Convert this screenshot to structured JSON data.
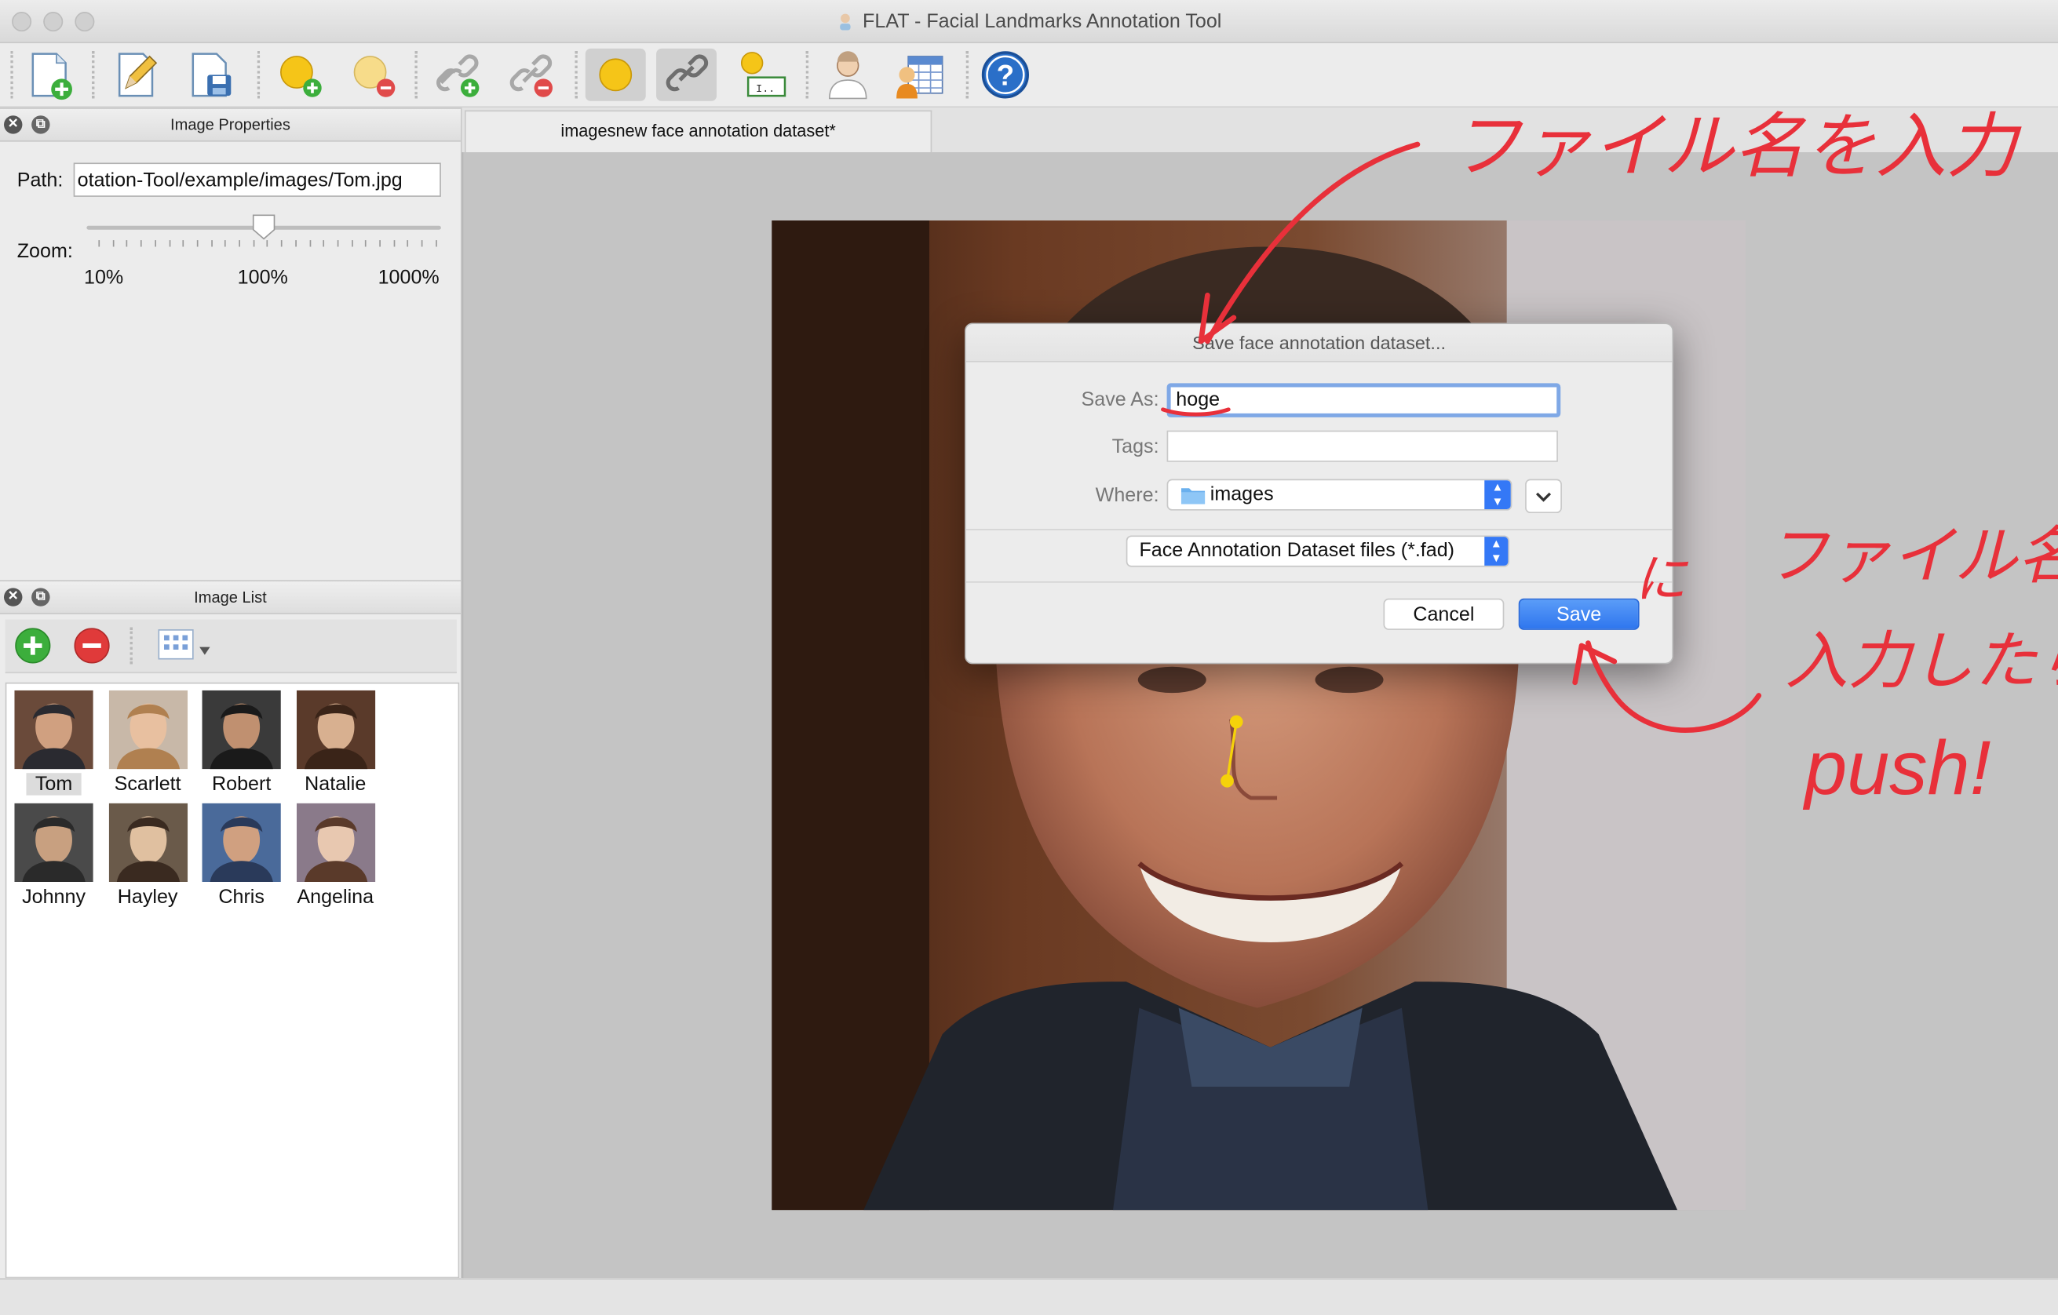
{
  "window": {
    "title": "FLAT - Facial Landmarks Annotation Tool"
  },
  "toolbar": {
    "buttons": [
      "new-dataset-icon",
      "edit-dataset-icon",
      "save-dataset-icon",
      "add-landmark-icon",
      "remove-landmark-icon",
      "add-link-icon",
      "remove-link-icon",
      "show-landmarks-icon",
      "show-links-icon",
      "landmark-id-icon",
      "face-fit-icon",
      "properties-grid-icon",
      "help-icon"
    ]
  },
  "properties_panel": {
    "title": "Image Properties",
    "path_label": "Path:",
    "path_value": "otation-Tool/example/images/Tom.jpg",
    "zoom_label": "Zoom:",
    "zoom_min": "10%",
    "zoom_mid": "100%",
    "zoom_max": "1000%",
    "zoom_value": 100
  },
  "image_list_panel": {
    "title": "Image List",
    "images": [
      {
        "name": "Tom",
        "selected": true
      },
      {
        "name": "Scarlett"
      },
      {
        "name": "Robert"
      },
      {
        "name": "Natalie"
      },
      {
        "name": "Johnny"
      },
      {
        "name": "Hayley"
      },
      {
        "name": "Chris"
      },
      {
        "name": "Angelina"
      }
    ]
  },
  "document_tab": {
    "label": "imagesnew face annotation dataset*"
  },
  "dialog": {
    "title": "Save face annotation dataset...",
    "save_as_label": "Save As:",
    "save_as_value": "hoge",
    "tags_label": "Tags:",
    "tags_value": "",
    "where_label": "Where:",
    "where_value": "images",
    "file_type": "Face Annotation Dataset files (*.fad)",
    "cancel_label": "Cancel",
    "save_label": "Save"
  },
  "annotations": {
    "top_note": "ファイル名を入力",
    "side_note_1": "ファイル名を",
    "side_note_2": "入力したら",
    "side_note_3": "push!",
    "side_note_prefix": "に",
    "color": "#e8303a"
  },
  "colors": {
    "accent": "#3478f6",
    "landmark": "#f5d20a"
  }
}
